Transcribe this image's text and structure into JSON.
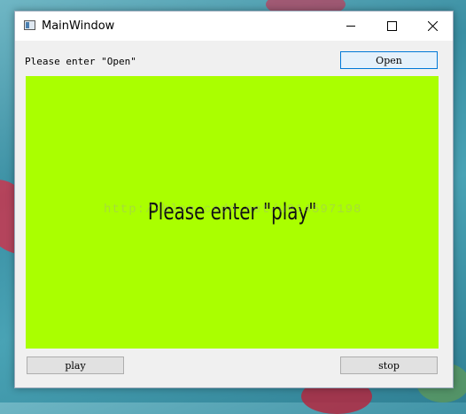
{
  "window": {
    "title": "MainWindow"
  },
  "controls": {
    "minimize": "minimize",
    "maximize": "maximize",
    "close": "close"
  },
  "top": {
    "label": "Please enter \"Open\"",
    "open_button": "Open"
  },
  "video": {
    "text": "Please enter \"play\"",
    "background": "#aaff00",
    "watermark": "http://blog.csdn.net/u014597198"
  },
  "bottom": {
    "play_button": "play",
    "stop_button": "stop"
  }
}
